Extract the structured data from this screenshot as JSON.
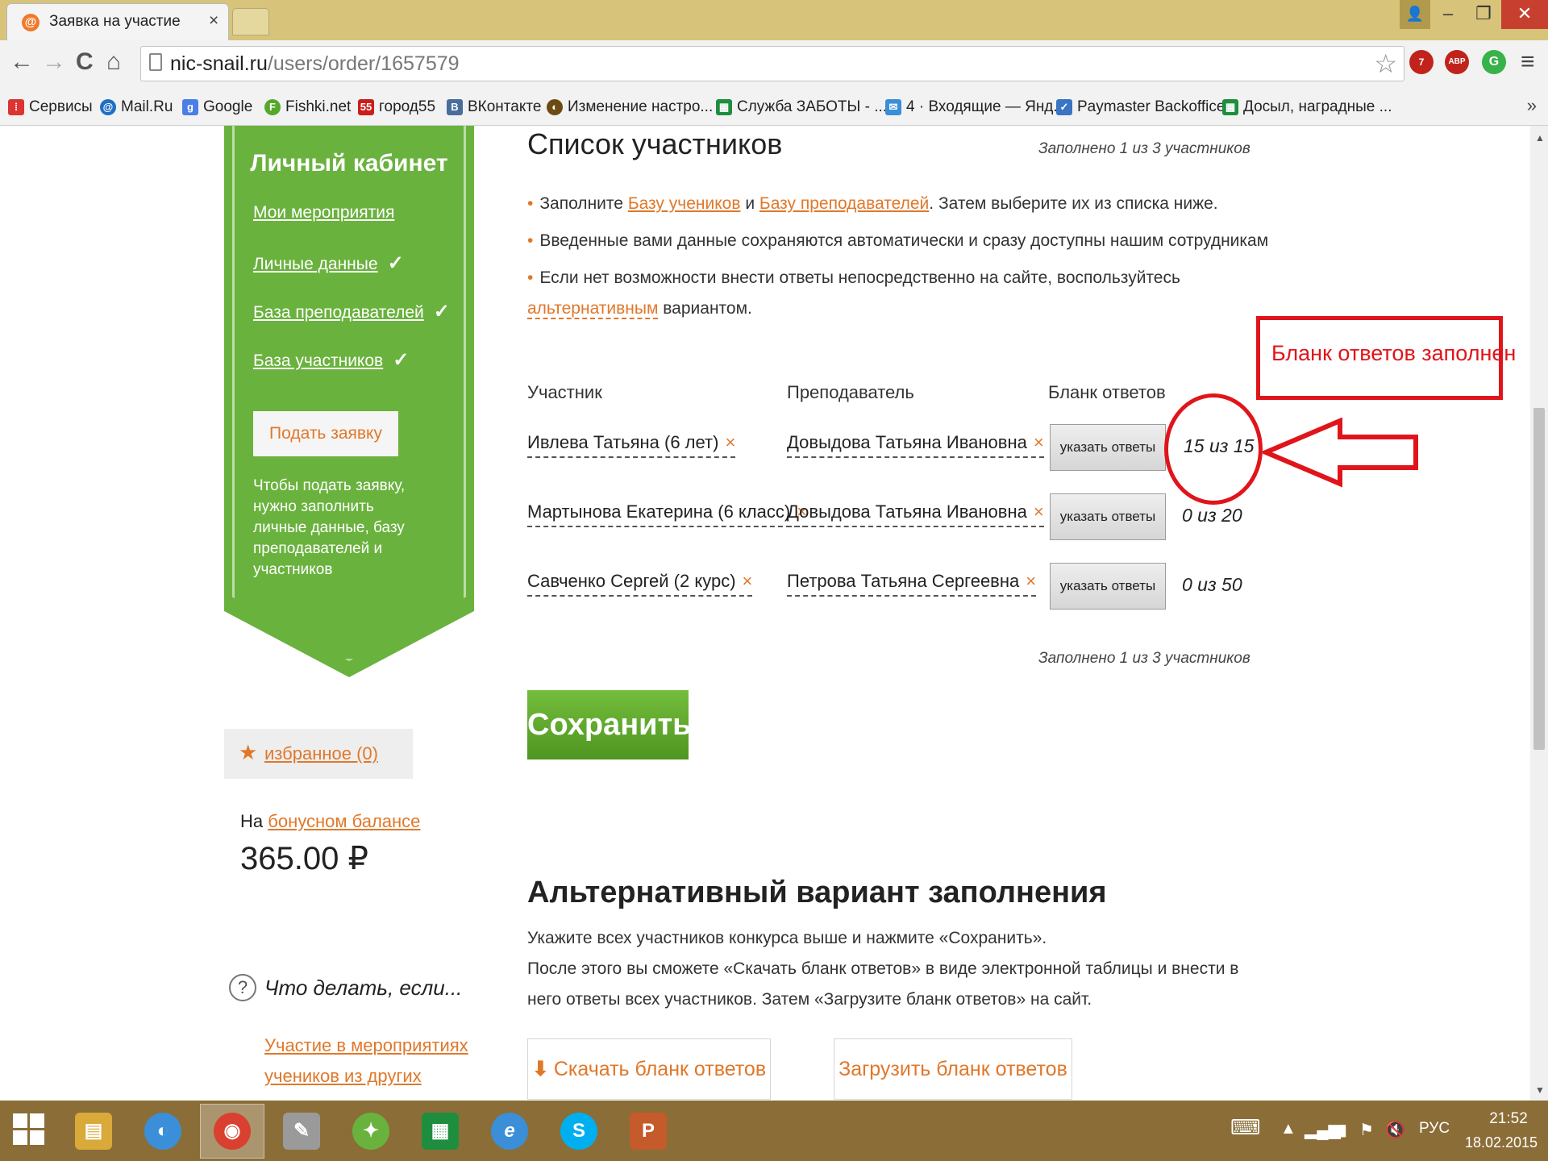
{
  "browser": {
    "tab_title": "Заявка на участие",
    "tab_close": "×",
    "url_domain": "nic-snail.ru",
    "url_path": "/users/order/1657579",
    "window_controls": {
      "user": "👤",
      "minimize": "–",
      "restore": "❐",
      "close": "✕"
    },
    "nav": {
      "back": "←",
      "forward": "→",
      "reload": "C",
      "home": "⌂",
      "star": "☆",
      "menu": "≡"
    },
    "extensions": [
      {
        "label": "7",
        "color": "#c0231b"
      },
      {
        "label": "ABP",
        "color": "#c0231b"
      },
      {
        "label": "G",
        "color": "#38b24a"
      }
    ],
    "bookmarks": [
      {
        "label": "Сервисы",
        "icon": "apps-icon",
        "color": "#d33"
      },
      {
        "label": "Mail.Ru",
        "icon": "mailru-icon",
        "color": "#1f6fc5"
      },
      {
        "label": "Google",
        "icon": "google-icon",
        "color": "#4a7fe5"
      },
      {
        "label": "Fishki.net",
        "icon": "fishki-icon",
        "color": "#55a82a"
      },
      {
        "label": "город55",
        "icon": "gorod55-icon",
        "color": "#cc1d1d"
      },
      {
        "label": "ВКонтакте",
        "icon": "vk-icon",
        "color": "#4a6e9c"
      },
      {
        "label": "Изменение настро...",
        "icon": "settings-page-icon",
        "color": "#6b4b13"
      },
      {
        "label": "Служба ЗАБОТЫ - ...",
        "icon": "sheet-icon",
        "color": "#1e8e3e"
      },
      {
        "label": "4 · Входящие — Янд...",
        "icon": "mail-icon",
        "color": "#3a8fd8"
      },
      {
        "label": "Paymaster Backoffice",
        "icon": "paymaster-icon",
        "color": "#3a74c4"
      },
      {
        "label": "Досыл, наградные ...",
        "icon": "sheet-icon",
        "color": "#1e8e3e"
      }
    ],
    "bookmarks_more": "»"
  },
  "sidebar": {
    "title": "Личный кабинет",
    "links": [
      {
        "label": "Мои мероприятия",
        "checked": false
      },
      {
        "label": "Личные данные",
        "checked": true
      },
      {
        "label": "База преподавателей",
        "checked": true
      },
      {
        "label": "База участников",
        "checked": true
      }
    ],
    "check_mark": "✓",
    "apply_button": "Подать заявку",
    "apply_note": "Чтобы подать заявку, нужно заполнить личные данные, базу преподавателей и участников",
    "favorites": "избранное (0)",
    "bonus_prefix": "На",
    "bonus_link": "бонусном балансе",
    "bonus_amount": "365.00 ₽",
    "help_icon": "?",
    "help_title": "Что делать, если...",
    "help_links": [
      "Участие в мероприятиях",
      "учеников из других"
    ]
  },
  "main": {
    "title": "Список участников",
    "filled_note_top": "Заполнено 1 из 3 участников",
    "filled_note_bottom": "Заполнено 1 из 3 участников",
    "bullets": {
      "b1_before": "Заполните",
      "b1_link1": "Базу учеников",
      "b1_mid": "и",
      "b1_link2": "Базу преподавателей",
      "b1_after": ". Затем выберите их из списка ниже.",
      "b2": "Введенные вами данные сохраняются автоматически и сразу доступны нашим сотрудникам",
      "b3_before": "Если нет возможности внести ответы непосредственно на сайте, воспользуйтесь",
      "b3_link": "альтернативным",
      "b3_after": "вариантом."
    },
    "columns": {
      "participant": "Участник",
      "teacher": "Преподаватель",
      "answers": "Бланк ответов"
    },
    "remove_symbol": "×",
    "rows": [
      {
        "participant": "Ивлева Татьяна (6 лет)",
        "teacher": "Довыдова Татьяна Ивановна",
        "button": "указать ответы",
        "score": "15 из 15"
      },
      {
        "participant": "Мартынова Екатерина (6 класс)",
        "teacher": "Довыдова Татьяна Ивановна",
        "button": "указать ответы",
        "score": "0 из 20"
      },
      {
        "participant": "Савченко Сергей (2 курс)",
        "teacher": "Петрова Татьяна Сергеевна",
        "button": "указать ответы",
        "score": "0 из 50"
      }
    ],
    "save_button": "Сохранить",
    "alt_title": "Альтернативный вариант заполнения",
    "alt_lines": [
      "Укажите всех участников конкурса выше и нажмите «Сохранить».",
      "После этого вы сможете «Скачать бланк ответов» в виде электронной таблицы и внести в",
      "него ответы всех участников. Затем «Загрузите бланк ответов» на сайт."
    ],
    "download_button": "Скачать бланк ответов",
    "upload_button": "Загрузить бланк ответов"
  },
  "annotation": {
    "text": "Бланк ответов заполнен",
    "color": "#e0151b"
  },
  "taskbar": {
    "apps": [
      {
        "name": "explorer",
        "color": "#d9a93a",
        "glyph": "▤"
      },
      {
        "name": "picasa",
        "color": "#3a8fd8",
        "glyph": "◐"
      },
      {
        "name": "chrome",
        "color": "#d9402f",
        "glyph": "◉"
      },
      {
        "name": "word-doc",
        "color": "#9a9a9a",
        "glyph": "✎"
      },
      {
        "name": "green-app",
        "color": "#6ab23e",
        "glyph": "✦"
      },
      {
        "name": "store",
        "color": "#1e8e3e",
        "glyph": "▦"
      },
      {
        "name": "ie",
        "color": "#3a8fd8",
        "glyph": "e"
      },
      {
        "name": "skype",
        "color": "#00aff0",
        "glyph": "S"
      },
      {
        "name": "powerpoint",
        "color": "#c55a2a",
        "glyph": "P"
      }
    ],
    "tray": {
      "language": "РУС",
      "time": "21:52",
      "date": "18.02.2015"
    }
  }
}
